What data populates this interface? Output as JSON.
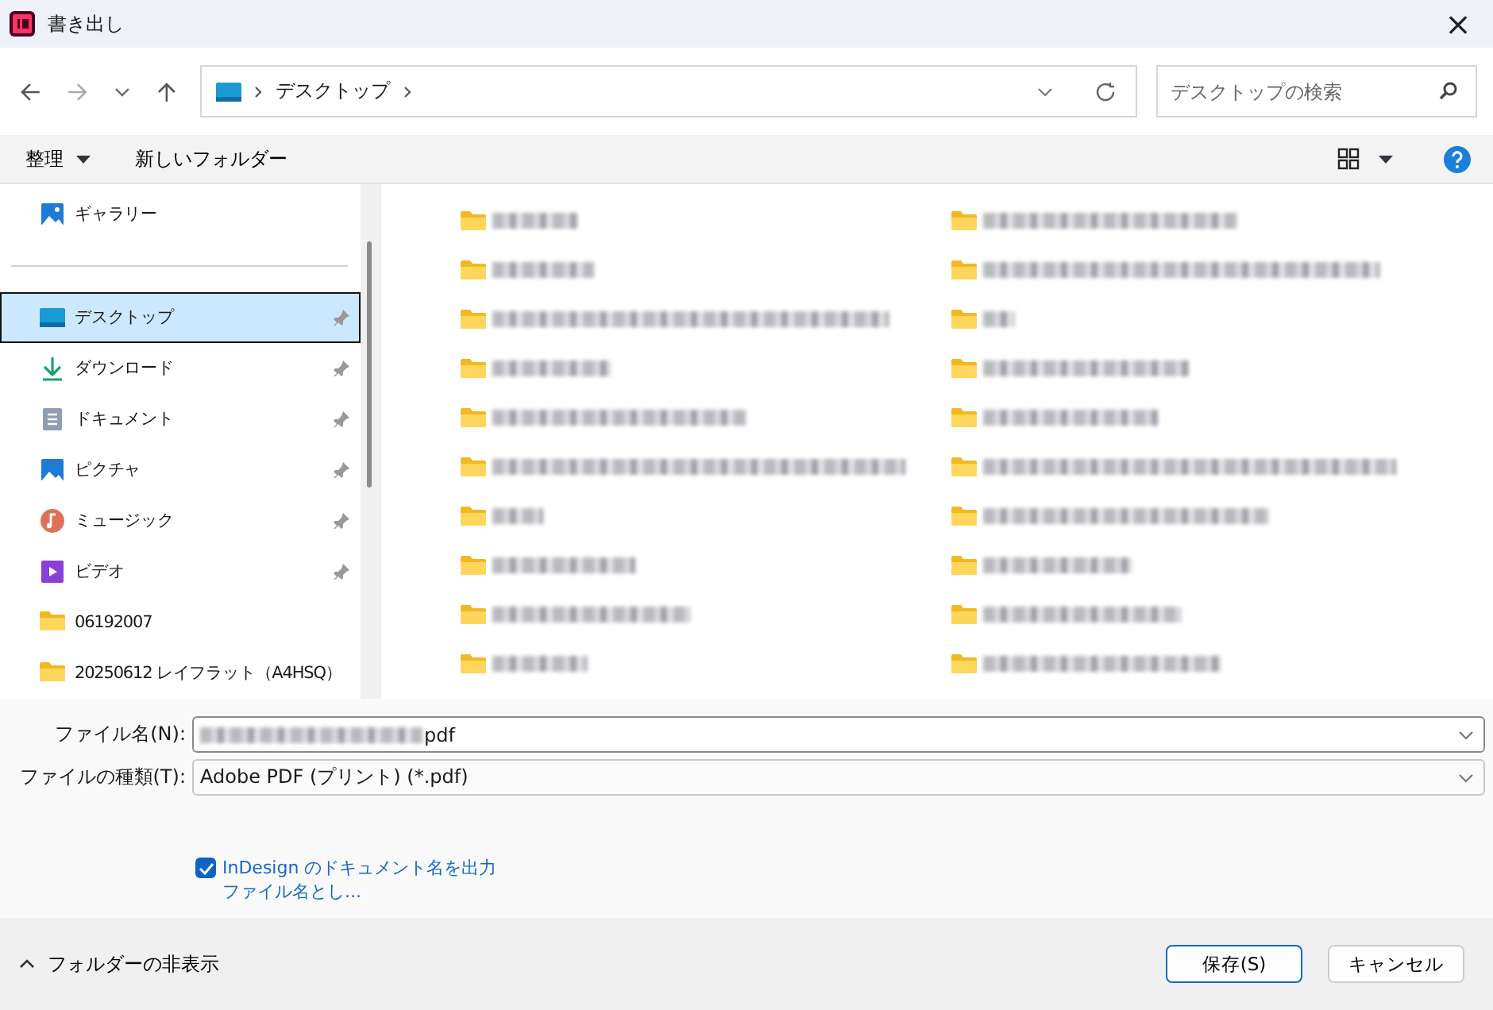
{
  "window": {
    "title": "書き出し",
    "close": "×"
  },
  "address_bar": {
    "path": [
      "デスクトップ"
    ]
  },
  "search": {
    "placeholder": "デスクトップの検索"
  },
  "toolbar": {
    "organize": "整理",
    "new_folder": "新しいフォルダー"
  },
  "sidebar": {
    "items": [
      {
        "kind": "gallery",
        "label": "ギャラリー",
        "pinned": false,
        "selected": false
      },
      {
        "kind": "desktop",
        "label": "デスクトップ",
        "pinned": true,
        "selected": true
      },
      {
        "kind": "download",
        "label": "ダウンロード",
        "pinned": true,
        "selected": false
      },
      {
        "kind": "documents",
        "label": "ドキュメント",
        "pinned": true,
        "selected": false
      },
      {
        "kind": "pictures",
        "label": "ピクチャ",
        "pinned": true,
        "selected": false
      },
      {
        "kind": "music",
        "label": "ミュージック",
        "pinned": true,
        "selected": false
      },
      {
        "kind": "video",
        "label": "ビデオ",
        "pinned": true,
        "selected": false
      },
      {
        "kind": "folder",
        "label": "06192007",
        "pinned": false,
        "selected": false
      },
      {
        "kind": "folder",
        "label": "20250612 レイフラット（A4HSQ）",
        "pinned": false,
        "selected": false
      }
    ]
  },
  "files": [
    {
      "kind": "folder",
      "redacted": true
    },
    {
      "kind": "folder",
      "redacted": true
    },
    {
      "kind": "folder",
      "redacted": true
    },
    {
      "kind": "folder",
      "redacted": true
    },
    {
      "kind": "folder",
      "redacted": true
    },
    {
      "kind": "folder",
      "redacted": true
    },
    {
      "kind": "folder",
      "redacted": true
    },
    {
      "kind": "folder",
      "redacted": true
    },
    {
      "kind": "folder",
      "redacted": true
    },
    {
      "kind": "folder",
      "redacted": true
    },
    {
      "kind": "folder",
      "redacted": true
    },
    {
      "kind": "folder",
      "redacted": true
    },
    {
      "kind": "folder",
      "redacted": true
    },
    {
      "kind": "folder",
      "redacted": true
    },
    {
      "kind": "folder",
      "redacted": true
    },
    {
      "kind": "folder",
      "redacted": true
    },
    {
      "kind": "folder",
      "redacted": true
    },
    {
      "kind": "folder",
      "redacted": true
    },
    {
      "kind": "folder",
      "redacted": true
    },
    {
      "kind": "folder",
      "redacted": true
    }
  ],
  "form": {
    "file_name": {
      "label": "ファイル名(N):",
      "value": "pdf",
      "redacted_prefix": true
    },
    "file_type": {
      "label": "ファイルの種類(T):",
      "value": "Adobe PDF (プリント) (*.pdf)"
    },
    "option": {
      "label": "InDesign のドキュメント名を出力ファイル名とし...",
      "checked": true
    }
  },
  "footer": {
    "hide_folders": "フォルダーの非表示",
    "buttons": [
      {
        "label": "保存(S)",
        "default": true
      },
      {
        "label": "キャンセル",
        "default": false
      }
    ]
  }
}
